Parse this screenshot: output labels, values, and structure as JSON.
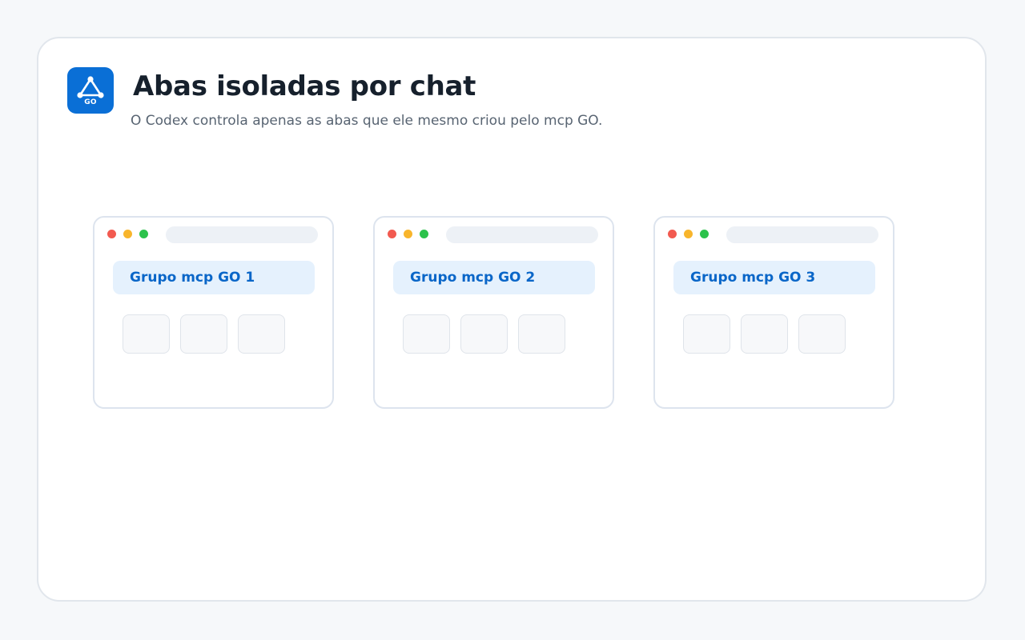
{
  "header": {
    "logo_text": "GO",
    "title": "Abas isoladas por chat",
    "subtitle": "O Codex controla apenas as abas que ele mesmo criou pelo mcp GO."
  },
  "windows": [
    {
      "group_label": "Grupo mcp GO 1"
    },
    {
      "group_label": "Grupo mcp GO 2"
    },
    {
      "group_label": "Grupo mcp GO 3"
    }
  ],
  "icons": {
    "logo": "share-triangle-icon"
  },
  "colors": {
    "accent": "#0a6fd6",
    "group_tab_bg": "#e5f1fd",
    "group_tab_text": "#0a66c8",
    "dot_red": "#f25a50",
    "dot_yellow": "#f8b52c",
    "dot_green": "#2cc24b"
  }
}
